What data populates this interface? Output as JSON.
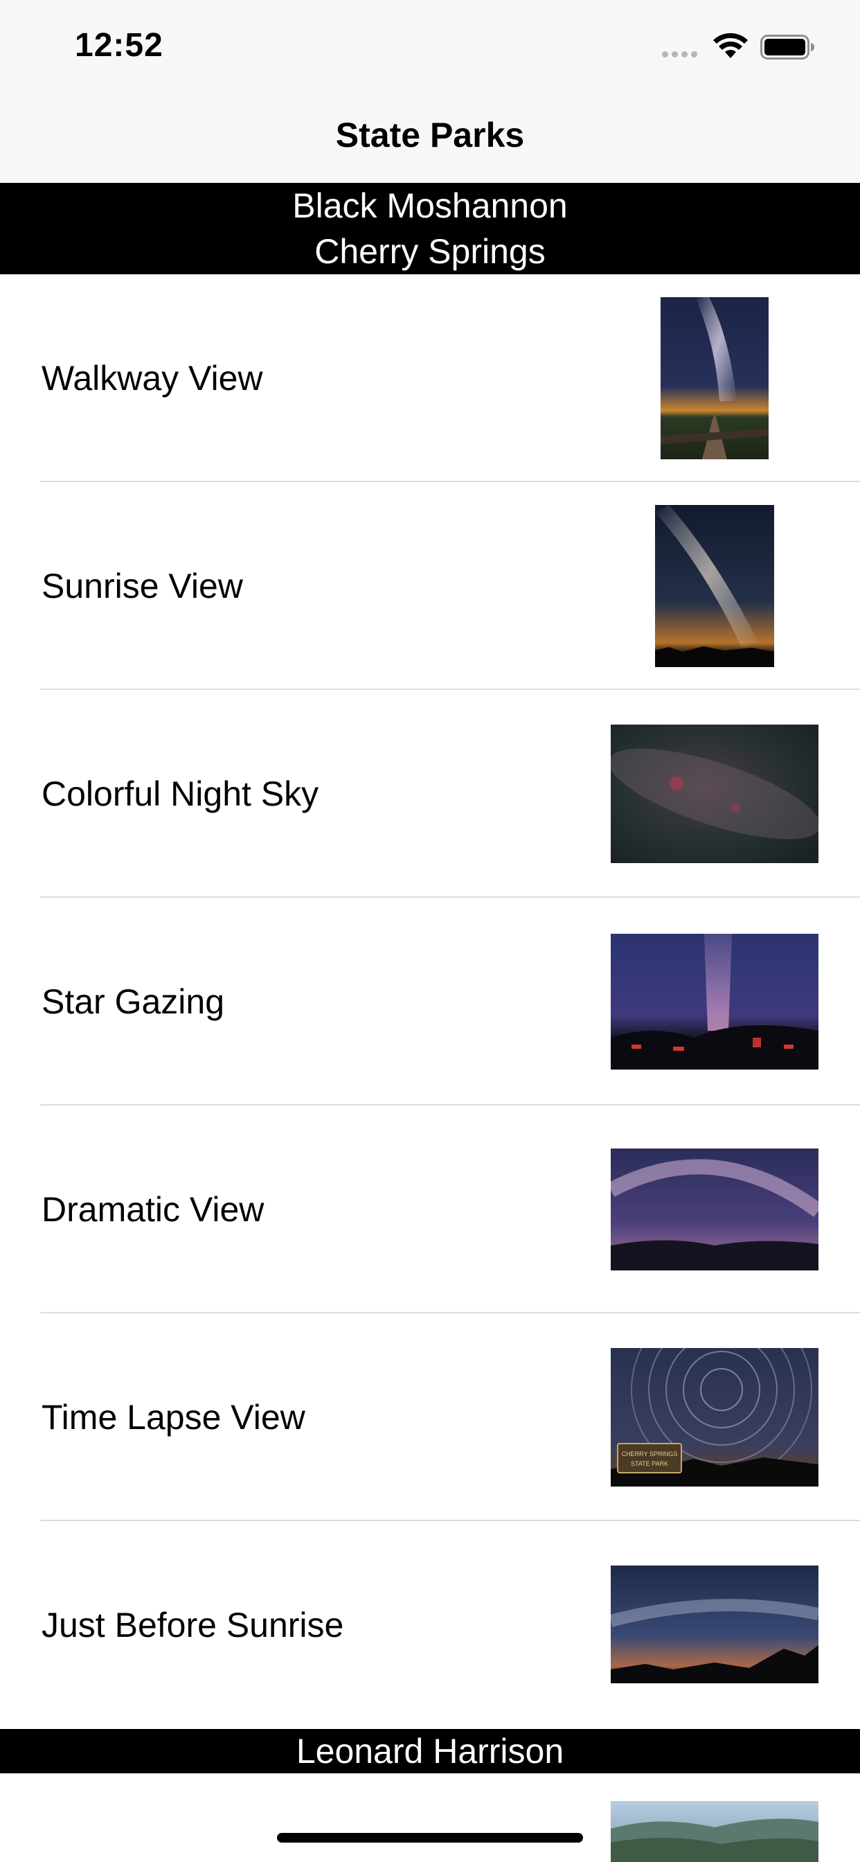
{
  "status_bar": {
    "time": "12:52",
    "icons": [
      "signal-dots-icon",
      "wifi-icon",
      "battery-icon"
    ]
  },
  "nav": {
    "title": "State Parks"
  },
  "sections": [
    {
      "headers": [
        "Black Moshannon",
        "Cherry Springs"
      ],
      "rows": [
        {
          "label": "Walkway View"
        },
        {
          "label": "Sunrise View"
        },
        {
          "label": "Colorful Night Sky"
        },
        {
          "label": "Star Gazing"
        },
        {
          "label": "Dramatic View"
        },
        {
          "label": "Time Lapse View",
          "sign_text": [
            "CHERRY SPRINGS",
            "STATE PARK"
          ]
        },
        {
          "label": "Just Before Sunrise"
        }
      ]
    },
    {
      "headers": [
        "Leonard Harrison"
      ],
      "rows": [
        {
          "label": ""
        }
      ]
    }
  ],
  "colors": {
    "bar_background": "#f7f7f7",
    "section_header_background": "#000000",
    "section_header_text": "#ffffff",
    "divider": "#dcdcdc"
  }
}
